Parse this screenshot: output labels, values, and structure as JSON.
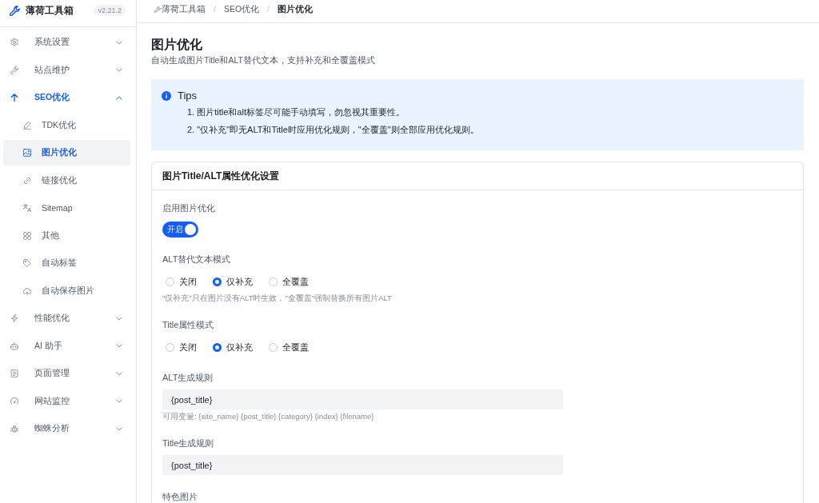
{
  "sidebar": {
    "brand": {
      "name": "薄荷工具箱",
      "version": "v2.21.2"
    },
    "items": [
      {
        "label": "系统设置",
        "selected": false,
        "expanded": false
      },
      {
        "label": "站点维护",
        "selected": false,
        "expanded": false
      },
      {
        "label": "SEO优化",
        "selected": false,
        "expanded": true,
        "children": [
          {
            "label": "TDK优化",
            "selected": false
          },
          {
            "label": "图片优化",
            "selected": true
          },
          {
            "label": "链接优化",
            "selected": false
          },
          {
            "label": "Sitemap",
            "selected": false
          },
          {
            "label": "其他",
            "selected": false
          },
          {
            "label": "自动标签",
            "selected": false
          },
          {
            "label": "自动保存图片",
            "selected": false
          }
        ]
      },
      {
        "label": "性能优化",
        "selected": false,
        "expanded": false
      },
      {
        "label": "AI 助手",
        "selected": false,
        "expanded": false
      },
      {
        "label": "页面管理",
        "selected": false,
        "expanded": false
      },
      {
        "label": "网站监控",
        "selected": false,
        "expanded": false
      },
      {
        "label": "蜘蛛分析",
        "selected": false,
        "expanded": false
      }
    ]
  },
  "breadcrumb": [
    {
      "label": "薄荷工具箱",
      "current": false
    },
    {
      "separator": "/",
      "label": "SEO优化",
      "current": false
    },
    {
      "separator": "/",
      "label": "图片优化",
      "current": true
    }
  ],
  "page": {
    "title": "图片优化",
    "subtitle": "自动生成图片Title和ALT替代文本，支持补充和全覆盖模式"
  },
  "tips": {
    "title": "Tips",
    "lines": [
      "1. 图片title和alt标签尽可能手动填写，勿忽视其重要性。",
      "2. \"仅补充\"即无ALT和Title时应用优化规则，\"全覆盖\"则全部应用优化规则。"
    ]
  },
  "card": {
    "title": "图片Title/ALT属性优化设置",
    "fields": [
      {
        "kind": "switch",
        "label": "启用图片优化",
        "on": true,
        "text": "开启"
      },
      {
        "kind": "radio",
        "label": "ALT替代文本模式",
        "options": [
          {
            "label": "关闭",
            "selected": false
          },
          {
            "label": "仅补充",
            "selected": true
          },
          {
            "label": "全覆盖",
            "selected": false
          }
        ],
        "hint": "\"仅补充\"只在图片没有ALT时生效，\"全覆盖\"强制替换所有图片ALT"
      },
      {
        "kind": "radio",
        "label": "Title属性模式",
        "options": [
          {
            "label": "关闭",
            "selected": false
          },
          {
            "label": "仅补充",
            "selected": true
          },
          {
            "label": "全覆盖",
            "selected": false
          }
        ]
      },
      {
        "kind": "input",
        "label": "ALT生成规则",
        "value": "{post_title}",
        "hint": "可用变量: {site_name} {post_title} {category} {index} {filename}"
      },
      {
        "kind": "input",
        "label": "Title生成规则",
        "value": "{post_title}"
      },
      {
        "kind": "label",
        "label": "特色图片"
      }
    ]
  }
}
